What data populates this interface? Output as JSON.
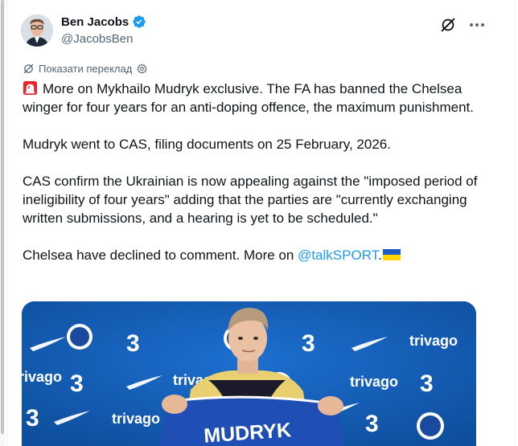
{
  "author": {
    "name": "Ben Jacobs",
    "handle": "@JacobsBen",
    "verified": true
  },
  "colors": {
    "accent": "#1d9bf0",
    "text": "#0f1419",
    "secondary": "#536471",
    "media_background": "#1460b8"
  },
  "translate": {
    "label": "Показати переклад"
  },
  "tweet": {
    "paragraph1": "More on Mykhailo Mudryk exclusive. The FA has banned the Chelsea winger for four years for an anti-doping offence, the maximum punishment.",
    "paragraph2": "Mudryk went to CAS, filing documents on 25 February, 2026.",
    "paragraph3": "CAS confirm the Ukrainian is now appealing against the \"imposed period of ineligibility of four years\" adding that the parties are \"currently exchanging written submissions, and a hearing is yet to be scheduled.\"",
    "paragraph4_prefix": "Chelsea have declined to comment. More on ",
    "mention": "@talkSPORT",
    "paragraph4_suffix": "."
  },
  "icons": {
    "leading_emoji": "siren-emoji",
    "trailing_emoji": "ukraine-flag-emoji",
    "header_actions": [
      "grok-icon",
      "more-icon"
    ],
    "translate_icons": [
      "translate-icon",
      "settings-icon"
    ]
  },
  "media": {
    "sponsor_text": "trivago",
    "shirt_text": "MUDRYK"
  }
}
